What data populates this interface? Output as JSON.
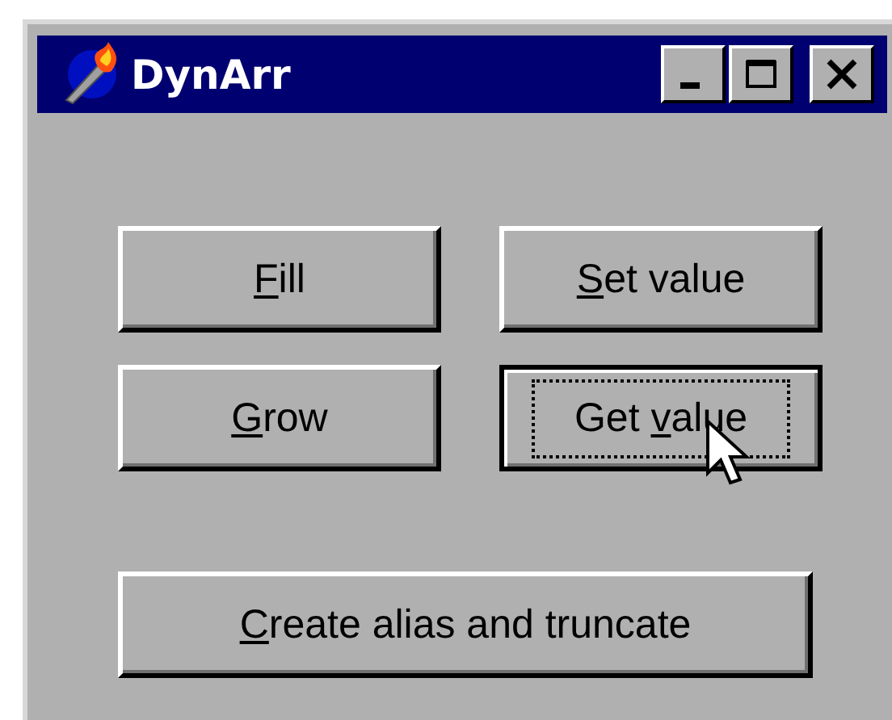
{
  "window": {
    "title": "DynArr",
    "controls": [
      {
        "kind": "minimize"
      },
      {
        "kind": "maximize"
      },
      {
        "kind": "close"
      }
    ]
  },
  "buttons": [
    {
      "key": "F",
      "after": "ill",
      "focused": false,
      "hovered": false
    },
    {
      "key": "S",
      "after": "et value",
      "focused": false,
      "hovered": false
    },
    {
      "key": "G",
      "after": "row",
      "focused": false,
      "hovered": false
    },
    {
      "before": "Get ",
      "key": "v",
      "after": "alue",
      "focused": true,
      "hovered": true
    }
  ],
  "wide_button": {
    "key": "C",
    "after": "reate alias and truncate",
    "focused": false,
    "hovered": false
  }
}
